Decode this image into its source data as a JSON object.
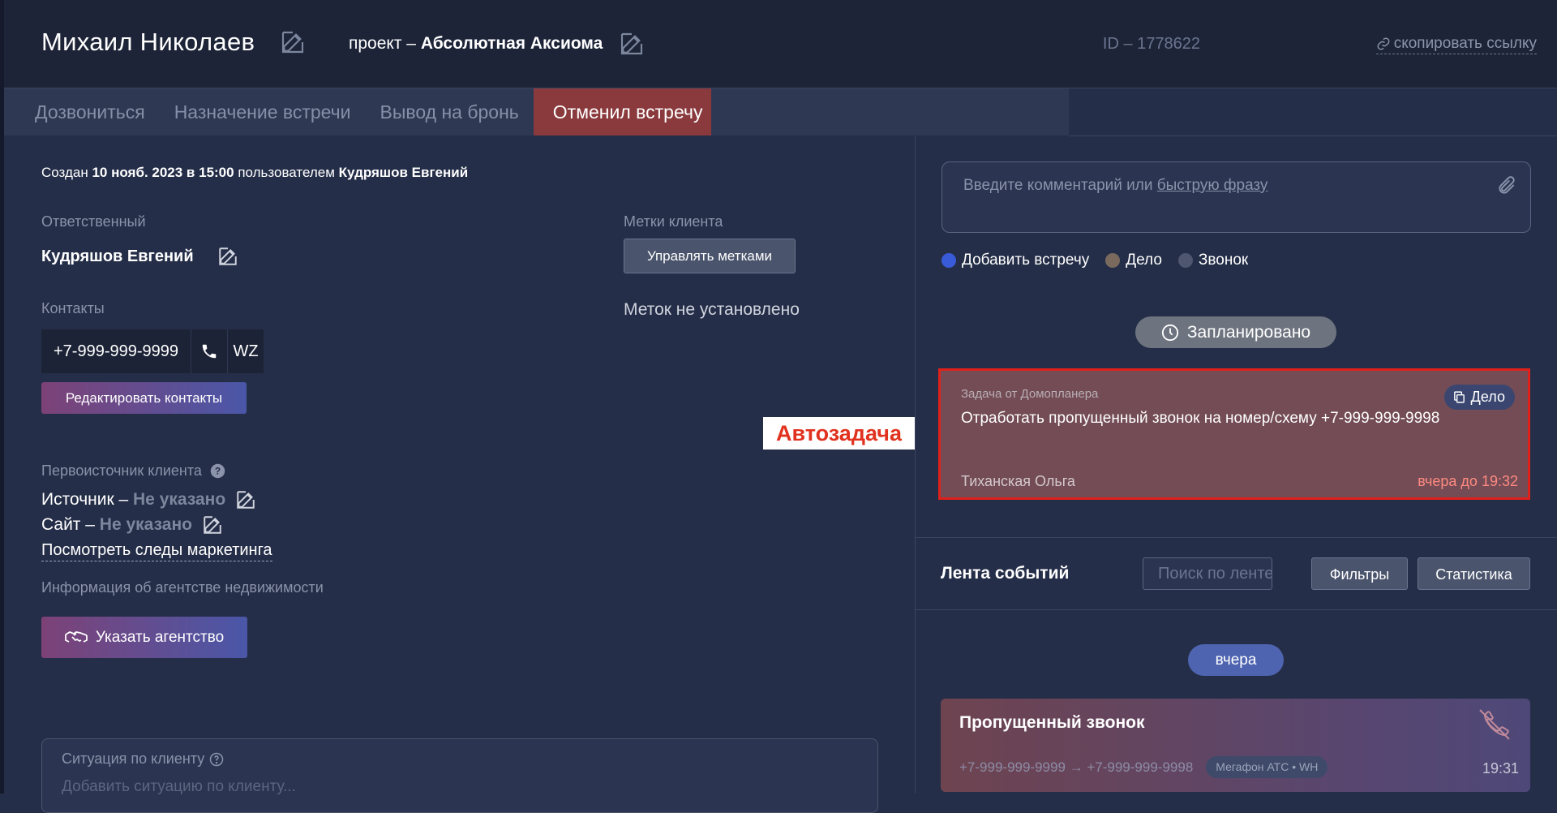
{
  "header": {
    "client_name": "Михаил Николаев",
    "project_prefix": "проект –",
    "project_name": "Абсолютная Аксиома",
    "lead_id": "ID – 1778622",
    "copy_link": "скопировать ссылку"
  },
  "stages": [
    {
      "label": "Дозвониться",
      "active": false
    },
    {
      "label": "Назначение встречи",
      "active": false
    },
    {
      "label": "Вывод на бронь",
      "active": false
    },
    {
      "label": "Отменил встречу",
      "active": true
    }
  ],
  "left": {
    "created": {
      "prefix": "Создан",
      "date": "10 нояб. 2023 в 15:00",
      "middle": "пользователем",
      "user": "Кудряшов Евгений"
    },
    "responsible_label": "Ответственный",
    "responsible_name": "Кудряшов Евгений",
    "contacts_label": "Контакты",
    "phone": "+7-999-999-9999",
    "wz": "WZ",
    "edit_contacts": "Редактировать контакты",
    "source_label": "Первоисточник клиента",
    "source_prefix": "Источник –",
    "source_value": "Не указано",
    "site_prefix": "Сайт –",
    "site_value": "Не указано",
    "marketing_link": "Посмотреть следы маркетинга",
    "agency_label": "Информация об агентстве недвижимости",
    "agency_button": "Указать агентство",
    "tags_label": "Метки клиента",
    "tags_button": "Управлять метками",
    "no_tags": "Меток не установлено",
    "situation_label": "Ситуация по клиенту",
    "situation_placeholder": "Добавить ситуацию по клиенту..."
  },
  "annotation": "Автозадача",
  "right": {
    "comment_placeholder_prefix": "Введите комментарий или",
    "comment_placeholder_link": "быструю фразу",
    "types": [
      {
        "label": "Добавить встречу",
        "color": "#3a5bd9"
      },
      {
        "label": "Дело",
        "color": "#7a6a5e"
      },
      {
        "label": "Звонок",
        "color": "#4e5670"
      }
    ],
    "planned": "Запланировано",
    "task": {
      "from": "Задача от Домопланера",
      "text": "Отработать пропущенный звонок на номер/схему +7-999-999-9998",
      "person": "Тиханская Ольга",
      "due": "вчера до 19:32",
      "badge": "Дело"
    },
    "feed": {
      "title": "Лента событий",
      "search_placeholder": "Поиск по ленте",
      "filters": "Фильтры",
      "stats": "Статистика",
      "day": "вчера"
    },
    "missed_call": {
      "title": "Пропущенный звонок",
      "numbers": "+7-999-999-9999 → +7-999-999-9998",
      "provider": "Мегафон АТС • WH",
      "time": "19:31"
    }
  },
  "colors": {
    "background": "#252e48",
    "header": "#1d2438",
    "active_stage": "#8a3a3d",
    "task_card": "#734c55",
    "highlight_border": "#e0201a",
    "annotation_text": "#e0321f"
  }
}
